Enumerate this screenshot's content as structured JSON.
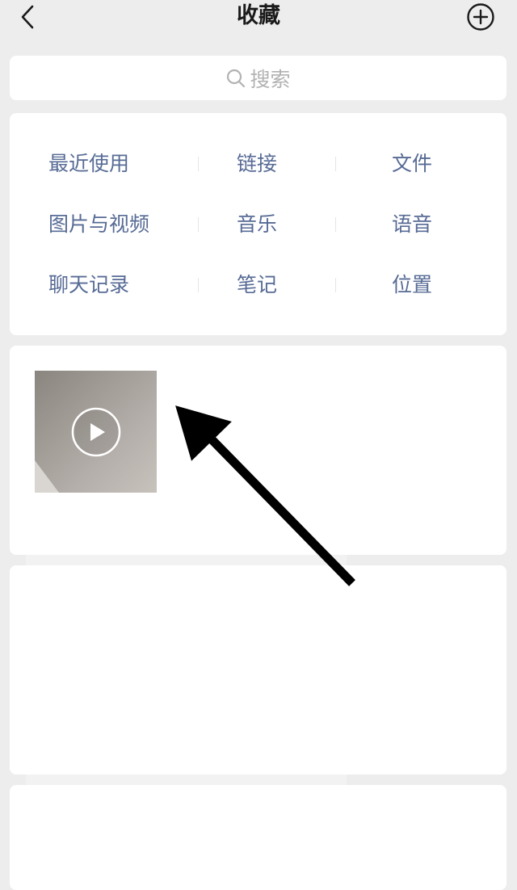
{
  "navbar": {
    "title": "收藏",
    "back_icon": "chevron-left-icon",
    "add_icon": "plus-circle-icon"
  },
  "search": {
    "placeholder": "搜索",
    "icon": "search-icon"
  },
  "categories": [
    "最近使用",
    "链接",
    "文件",
    "图片与视频",
    "音乐",
    "语音",
    "聊天记录",
    "笔记",
    "位置"
  ],
  "favorites": [
    {
      "type": "video",
      "icon": "play-icon"
    },
    {
      "type": "empty"
    },
    {
      "type": "empty"
    }
  ],
  "colors": {
    "background": "#ededed",
    "card": "#ffffff",
    "link_blue": "#576b95",
    "title": "#1a1a1a",
    "placeholder": "#b2b2b2"
  }
}
